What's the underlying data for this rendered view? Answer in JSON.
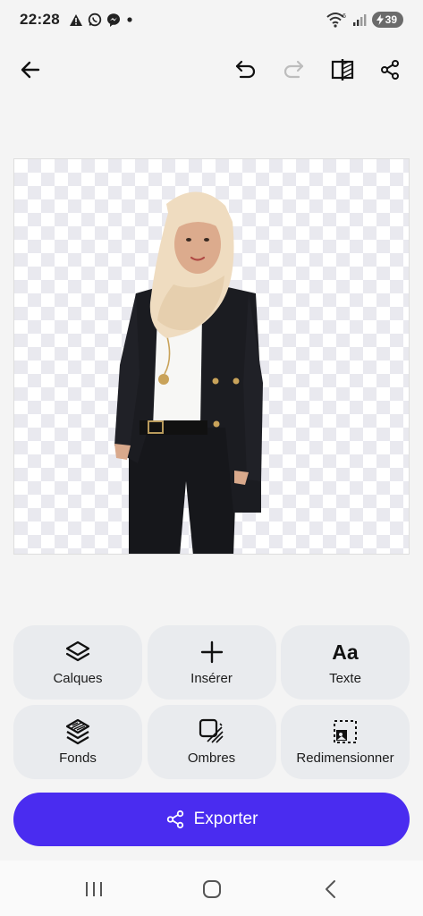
{
  "status_bar": {
    "time": "22:28",
    "notifications": [
      "warning-icon",
      "whatsapp-icon",
      "messenger-icon",
      "dot"
    ],
    "wifi_badge": "6",
    "battery": "39"
  },
  "toolbar": {
    "back": "arrow-left-icon",
    "undo": "undo-icon",
    "redo": "redo-icon",
    "compare": "compare-icon",
    "share": "share-icon"
  },
  "tools": [
    {
      "label": "Calques",
      "icon": "layers-icon"
    },
    {
      "label": "Insérer",
      "icon": "plus-icon"
    },
    {
      "label": "Texte",
      "icon": "text-icon",
      "glyph": "Aa"
    },
    {
      "label": "Fonds",
      "icon": "backgrounds-icon"
    },
    {
      "label": "Ombres",
      "icon": "shadow-icon"
    },
    {
      "label": "Redimensionner",
      "icon": "resize-icon"
    }
  ],
  "export": {
    "label": "Exporter",
    "icon": "share-icon"
  },
  "colors": {
    "accent": "#4a2cf0",
    "tool_bg": "#e9ebee",
    "page_bg": "#f4f4f4"
  }
}
